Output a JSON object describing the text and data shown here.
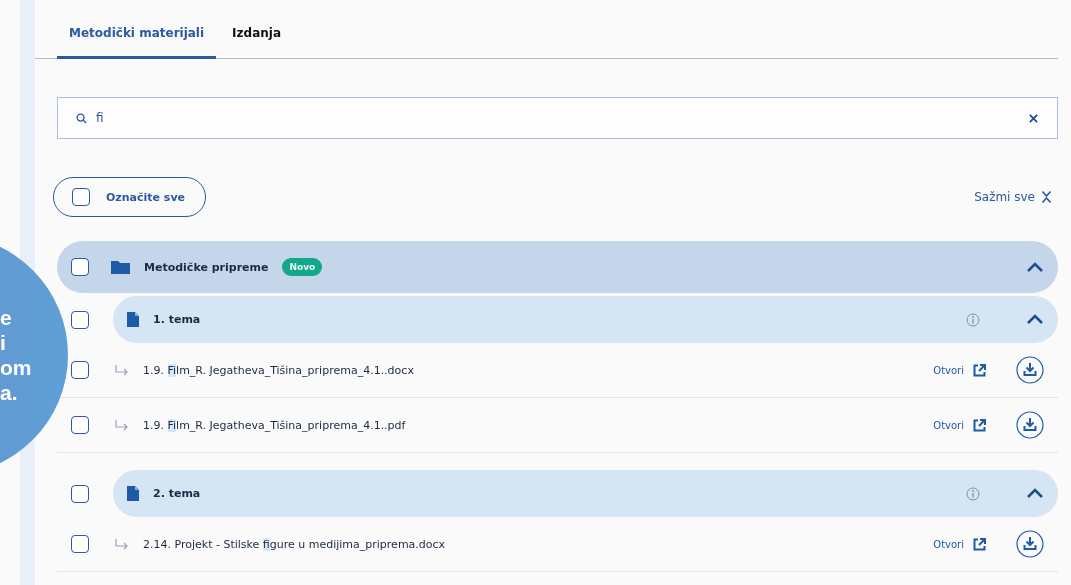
{
  "tabs": [
    {
      "label": "Metodički materijali",
      "selected": true
    },
    {
      "label": "Izdanja",
      "selected": false
    }
  ],
  "search": {
    "value": "fi"
  },
  "select_all": {
    "label": "Označite sve",
    "checked": false
  },
  "collapse_all": {
    "label": "Sažmi sve"
  },
  "callout": {
    "lines": [
      "e",
      "i",
      "om",
      "a."
    ]
  },
  "tree": [
    {
      "kind": "folder",
      "label": "Metodičke pripreme",
      "badge": "Novo",
      "checked": false,
      "expanded": true,
      "children": [
        {
          "kind": "topic",
          "label": "1. tema",
          "checked": false,
          "expanded": true,
          "children": [
            {
              "kind": "file",
              "checked": false,
              "parts": [
                {
                  "text": "1.9. ",
                  "match": false
                },
                {
                  "text": "Fi",
                  "match": true
                },
                {
                  "text": "lm_R. Jegatheva_Tišina_priprema_4.1..docx",
                  "match": false
                }
              ],
              "open_label": "Otvori"
            },
            {
              "kind": "file",
              "checked": false,
              "parts": [
                {
                  "text": "1.9. ",
                  "match": false
                },
                {
                  "text": "Fi",
                  "match": true
                },
                {
                  "text": "lm_R. Jegatheva_Tišina_priprema_4.1..pdf",
                  "match": false
                }
              ],
              "open_label": "Otvori"
            }
          ]
        },
        {
          "kind": "topic",
          "label": "2. tema",
          "checked": false,
          "expanded": true,
          "children": [
            {
              "kind": "file",
              "checked": false,
              "parts": [
                {
                  "text": "2.14. Projekt - Stilske ",
                  "match": false
                },
                {
                  "text": "fi",
                  "match": true
                },
                {
                  "text": "gure u medijima_priprema.docx",
                  "match": false
                }
              ],
              "open_label": "Otvori"
            }
          ]
        }
      ]
    }
  ]
}
